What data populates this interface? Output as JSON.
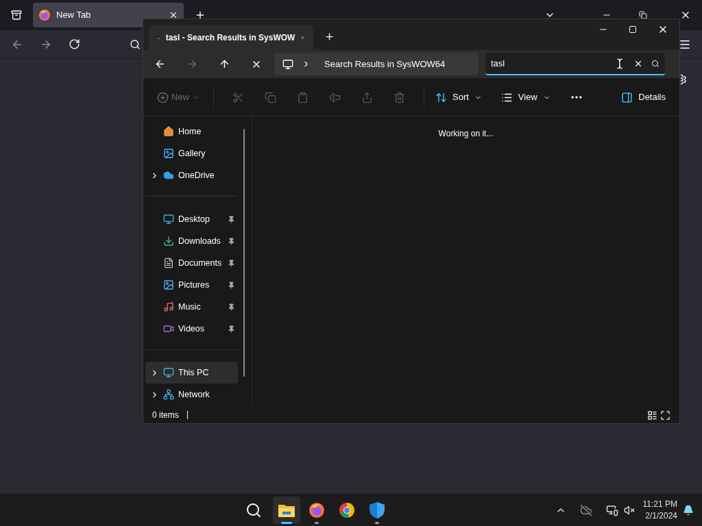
{
  "browser": {
    "tabs": [
      {
        "title": "New Tab",
        "selected": true
      }
    ]
  },
  "explorer": {
    "tabs": [
      {
        "title": "tasl - Search Results in SysWOW",
        "selected": true
      }
    ],
    "nav": {
      "back_disabled": false,
      "forward_disabled": true
    },
    "address": "Search Results in SysWOW64",
    "search": {
      "value": "tasl"
    },
    "command_bar": {
      "new": {
        "label": "New",
        "disabled": true
      },
      "actions": [
        {
          "disabled": true
        },
        {
          "disabled": true
        },
        {
          "disabled": true
        },
        {
          "disabled": true
        },
        {
          "disabled": true
        },
        {
          "disabled": true
        }
      ],
      "sort": {
        "label": "Sort"
      },
      "view": {
        "label": "View"
      },
      "details": {
        "label": "Details"
      }
    },
    "sidebar": {
      "groups": [
        [
          {
            "label": "Home",
            "expandable": false,
            "pinned": false,
            "selected": false
          },
          {
            "label": "Gallery",
            "expandable": false,
            "pinned": false,
            "selected": false
          },
          {
            "label": "OneDrive",
            "expandable": true,
            "pinned": false,
            "selected": false
          }
        ],
        [
          {
            "label": "Desktop",
            "expandable": false,
            "pinned": true,
            "selected": false
          },
          {
            "label": "Downloads",
            "expandable": false,
            "pinned": true,
            "selected": false
          },
          {
            "label": "Documents",
            "expandable": false,
            "pinned": true,
            "selected": false
          },
          {
            "label": "Pictures",
            "expandable": false,
            "pinned": true,
            "selected": false
          },
          {
            "label": "Music",
            "expandable": false,
            "pinned": true,
            "selected": false
          },
          {
            "label": "Videos",
            "expandable": false,
            "pinned": true,
            "selected": false
          }
        ],
        [
          {
            "label": "This PC",
            "expandable": true,
            "pinned": false,
            "selected": true
          },
          {
            "label": "Network",
            "expandable": true,
            "pinned": false,
            "selected": false
          }
        ]
      ]
    },
    "content": {
      "message": "Working on it..."
    },
    "status_bar": {
      "count": "0 items"
    }
  },
  "taskbar": {
    "apps": [
      {
        "selected": true,
        "running": true
      },
      {
        "selected": false,
        "running": true
      },
      {
        "selected": false,
        "running": false
      },
      {
        "selected": false,
        "running": true
      }
    ],
    "time": "11:21 PM",
    "date": "2/1/2024"
  }
}
